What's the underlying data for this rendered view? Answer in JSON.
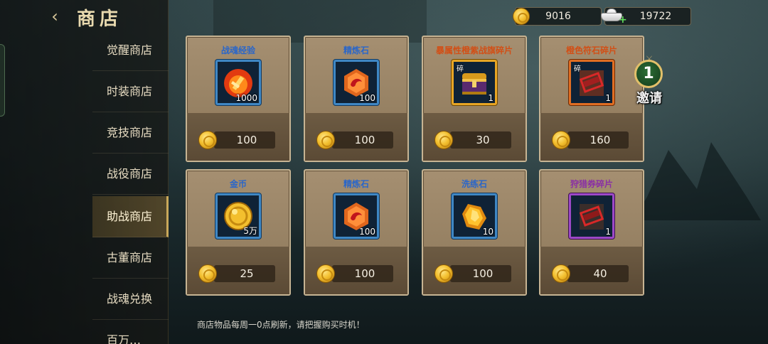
{
  "header": {
    "title": "商店",
    "back_icon": "back-arrow-icon"
  },
  "currency": {
    "coins": "9016",
    "ingots": "19722"
  },
  "sidebar": {
    "items": [
      {
        "label": "觉醒商店",
        "active": false
      },
      {
        "label": "时装商店",
        "active": false
      },
      {
        "label": "竞技商店",
        "active": false
      },
      {
        "label": "战役商店",
        "active": false
      },
      {
        "label": "助战商店",
        "active": true
      },
      {
        "label": "古董商店",
        "active": false
      },
      {
        "label": "战魂兑换",
        "active": false
      },
      {
        "label": "百万…",
        "active": false
      }
    ]
  },
  "shop": {
    "items": [
      {
        "name": "战魂经验",
        "count": "1000",
        "price": "100",
        "rarity": "blue"
      },
      {
        "name": "精炼石",
        "count": "100",
        "price": "100",
        "rarity": "blue"
      },
      {
        "name": "暴属性橙紫战旗碎片",
        "count": "1",
        "price": "30",
        "rarity": "gold",
        "tag": "碎"
      },
      {
        "name": "橙色符石碎片",
        "count": "1",
        "price": "160",
        "rarity": "orange",
        "tag": "碎"
      },
      {
        "name": "金币",
        "count": "5万",
        "price": "25",
        "rarity": "blue"
      },
      {
        "name": "精炼石",
        "count": "100",
        "price": "100",
        "rarity": "blue"
      },
      {
        "name": "洗练石",
        "count": "10",
        "price": "100",
        "rarity": "blue"
      },
      {
        "name": "狩猎券碎片",
        "count": "1",
        "price": "40",
        "rarity": "purple"
      }
    ]
  },
  "invite": {
    "count": "1",
    "label": "邀请"
  },
  "notice": "商店物品每周一0点刷新，请把握购买时机！",
  "colors": {
    "accent_gold": "#c9a85a",
    "card_bg": "#a58f71",
    "name_blue": "#2a66c9",
    "name_orange": "#d24f16",
    "name_purple": "#8a2fa5"
  }
}
